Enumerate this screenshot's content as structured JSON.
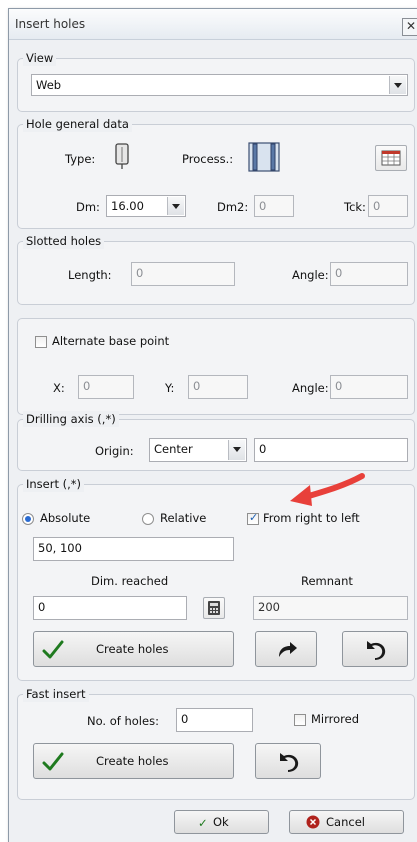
{
  "window": {
    "title": "Insert holes",
    "close_glyph": "✕"
  },
  "view": {
    "label": "View",
    "value": "Web"
  },
  "hole_general": {
    "label": "Hole general data",
    "type_label": "Type:",
    "process_label": "Process.:",
    "dm_label": "Dm:",
    "dm_value": "16.00",
    "dm2_label": "Dm2:",
    "dm2_value": "0",
    "tck_label": "Tck:",
    "tck_value": "0"
  },
  "slotted": {
    "label": "Slotted holes",
    "length_label": "Length:",
    "length_value": "0",
    "angle_label": "Angle:",
    "angle_value": "0"
  },
  "alternate": {
    "checkbox_label": "Alternate base point",
    "checked": false,
    "x_label": "X:",
    "x_value": "0",
    "y_label": "Y:",
    "y_value": "0",
    "angle_label": "Angle:",
    "angle_value": "0"
  },
  "drilling": {
    "label": "Drilling axis (,*)",
    "origin_label": "Origin:",
    "origin_value": "Center",
    "value": "0"
  },
  "insert": {
    "label": "Insert (,*)",
    "absolute_label": "Absolute",
    "absolute_selected": true,
    "relative_label": "Relative",
    "relative_selected": false,
    "rtl_label": "From right to left",
    "rtl_checked": true,
    "coords_value": "50, 100",
    "dim_reached_label": "Dim. reached",
    "dim_reached_value": "0",
    "remnant_label": "Remnant",
    "remnant_value": "200",
    "create_label": "Create holes"
  },
  "fast_insert": {
    "label": "Fast insert",
    "num_label": "No. of holes:",
    "num_value": "0",
    "mirrored_label": "Mirrored",
    "mirrored_checked": false,
    "create_label": "Create holes"
  },
  "footer": {
    "ok_label": "Ok",
    "cancel_label": "Cancel"
  },
  "colors": {
    "annotation_arrow": "#e8403a",
    "check_green": "#1f7a1f",
    "accent_blue": "#2a6bd1"
  },
  "icons": [
    "close-icon",
    "hole-type-icon",
    "process-icon",
    "table-icon",
    "calculator-icon",
    "checkmark-icon",
    "redo-arrow-icon",
    "undo-arrow-icon",
    "cancel-icon"
  ]
}
